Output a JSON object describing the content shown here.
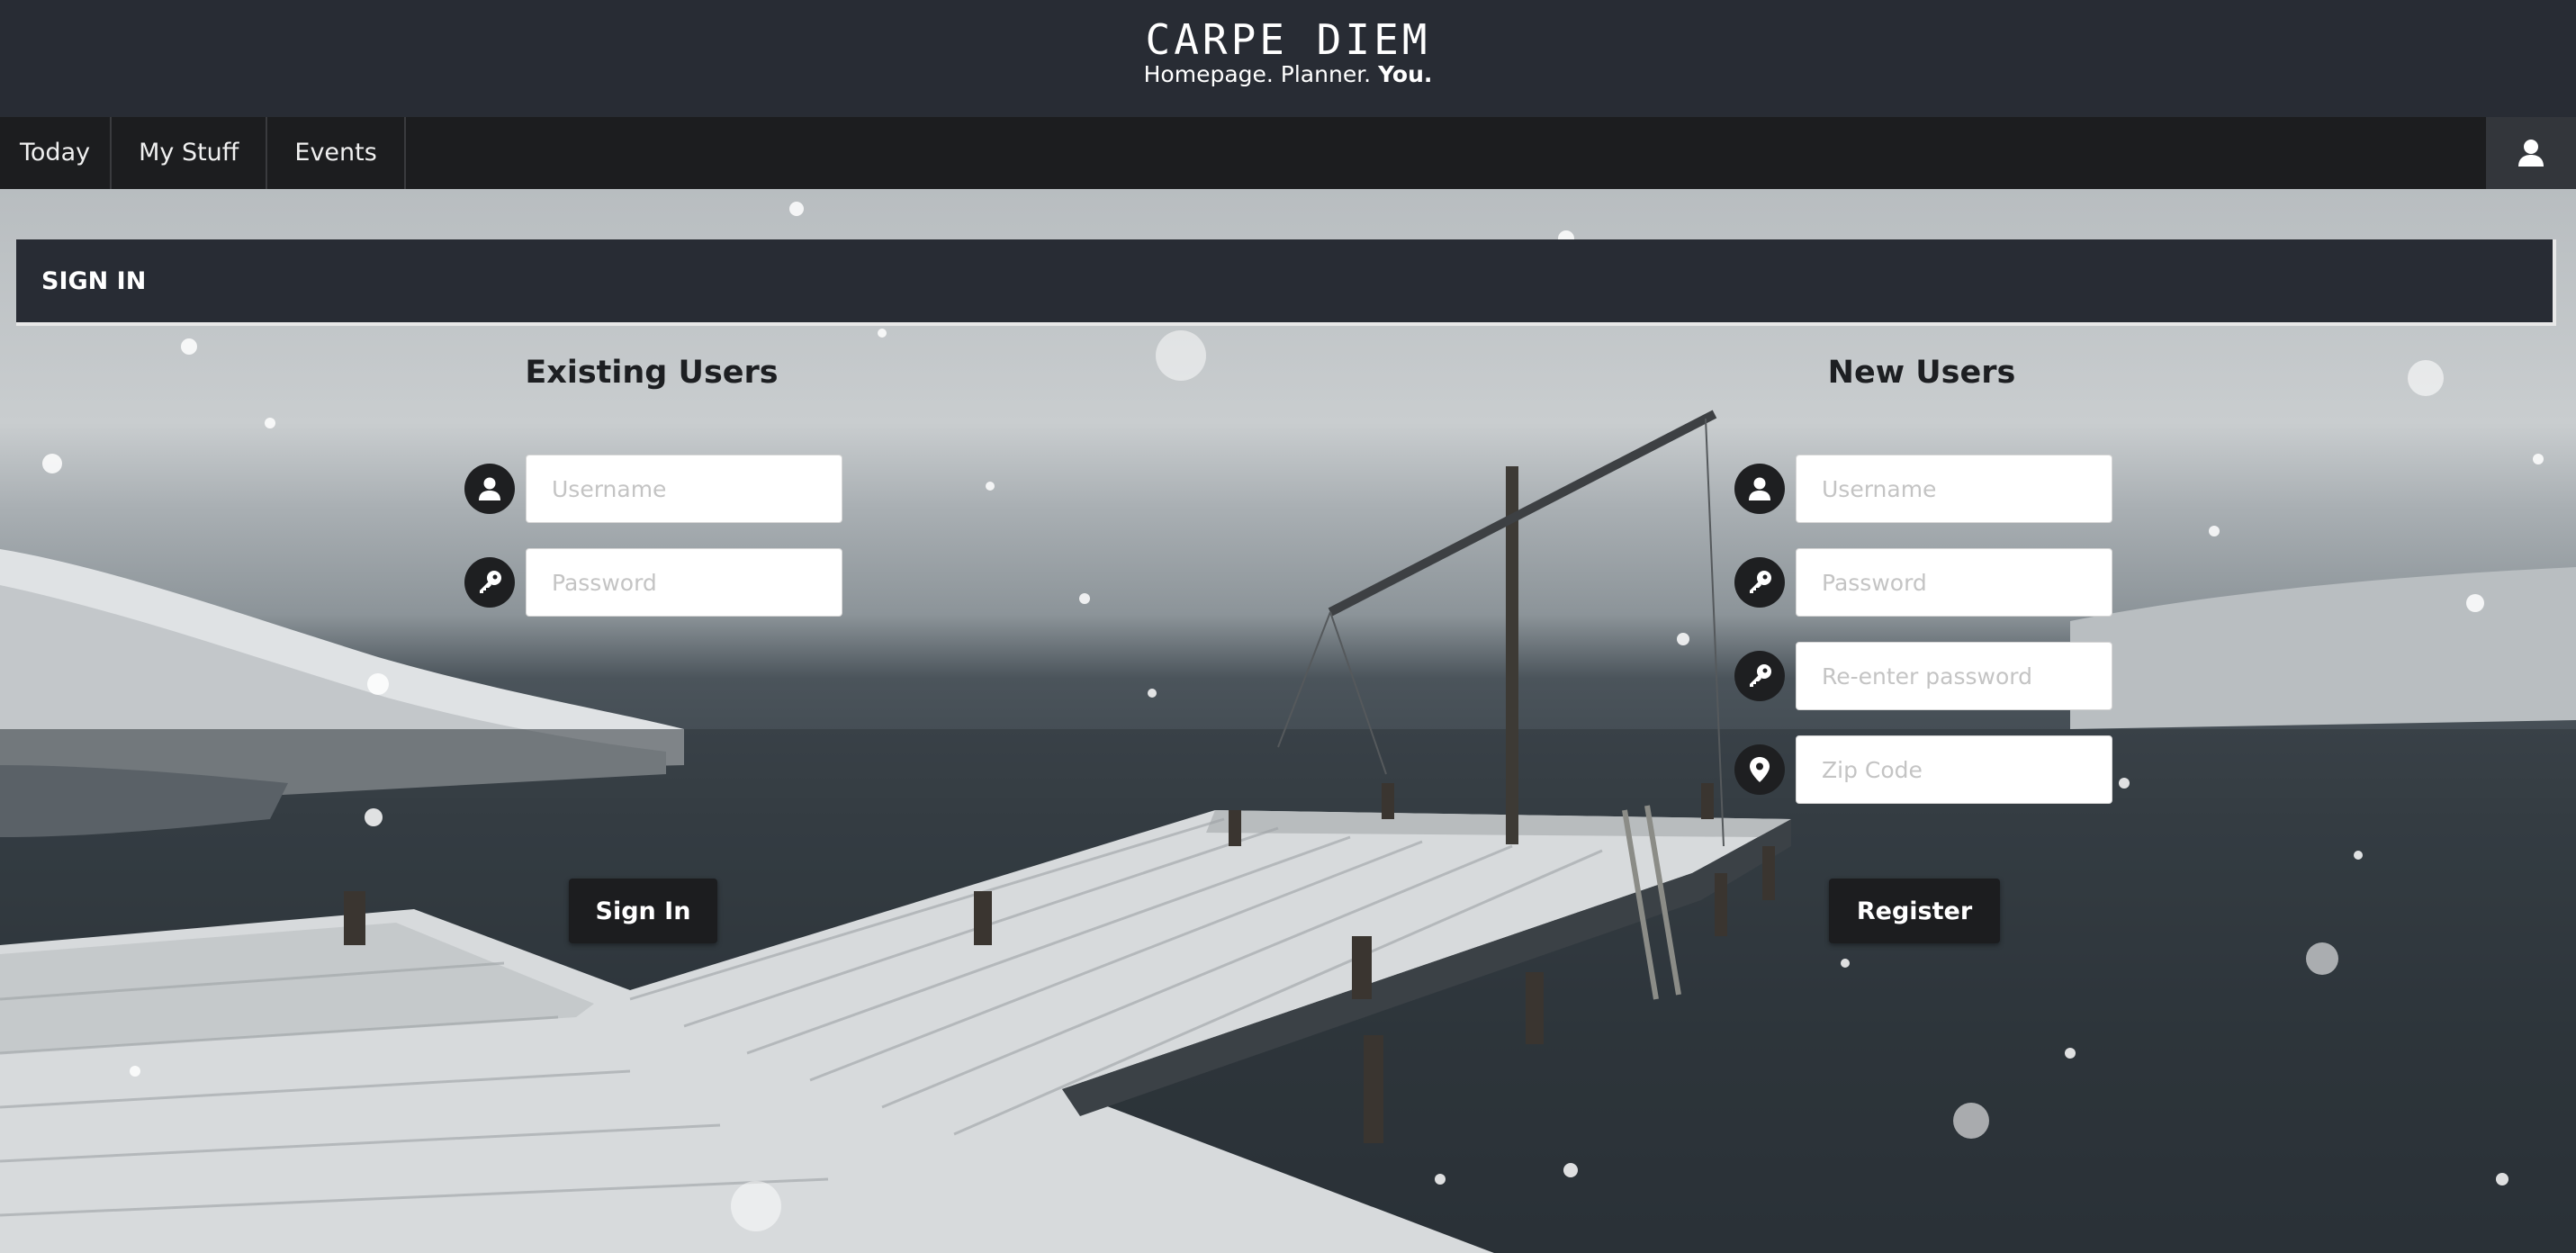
{
  "header": {
    "brand": "CARPE DIEM",
    "tagline_prefix": "Homepage. Planner.",
    "tagline_emphasis": "You."
  },
  "nav": {
    "items": [
      "Today",
      "My Stuff",
      "Events"
    ],
    "user_icon": "user-icon"
  },
  "signin": {
    "title": "SIGN IN"
  },
  "existing_users": {
    "heading": "Existing Users",
    "username_placeholder": "Username",
    "password_placeholder": "Password",
    "username_icon": "user-icon",
    "password_icon": "key-icon",
    "submit_label": "Sign In"
  },
  "new_users": {
    "heading": "New Users",
    "username_placeholder": "Username",
    "password_placeholder": "Password",
    "reenter_placeholder": "Re-enter password",
    "zip_placeholder": "Zip Code",
    "username_icon": "user-icon",
    "password_icon": "key-icon",
    "reenter_icon": "key-icon",
    "zip_icon": "map-pin-icon",
    "submit_label": "Register"
  },
  "colors": {
    "header_bg": "#282c34",
    "nav_bg": "#1c1d1f",
    "button_bg": "#1c1d1f"
  }
}
